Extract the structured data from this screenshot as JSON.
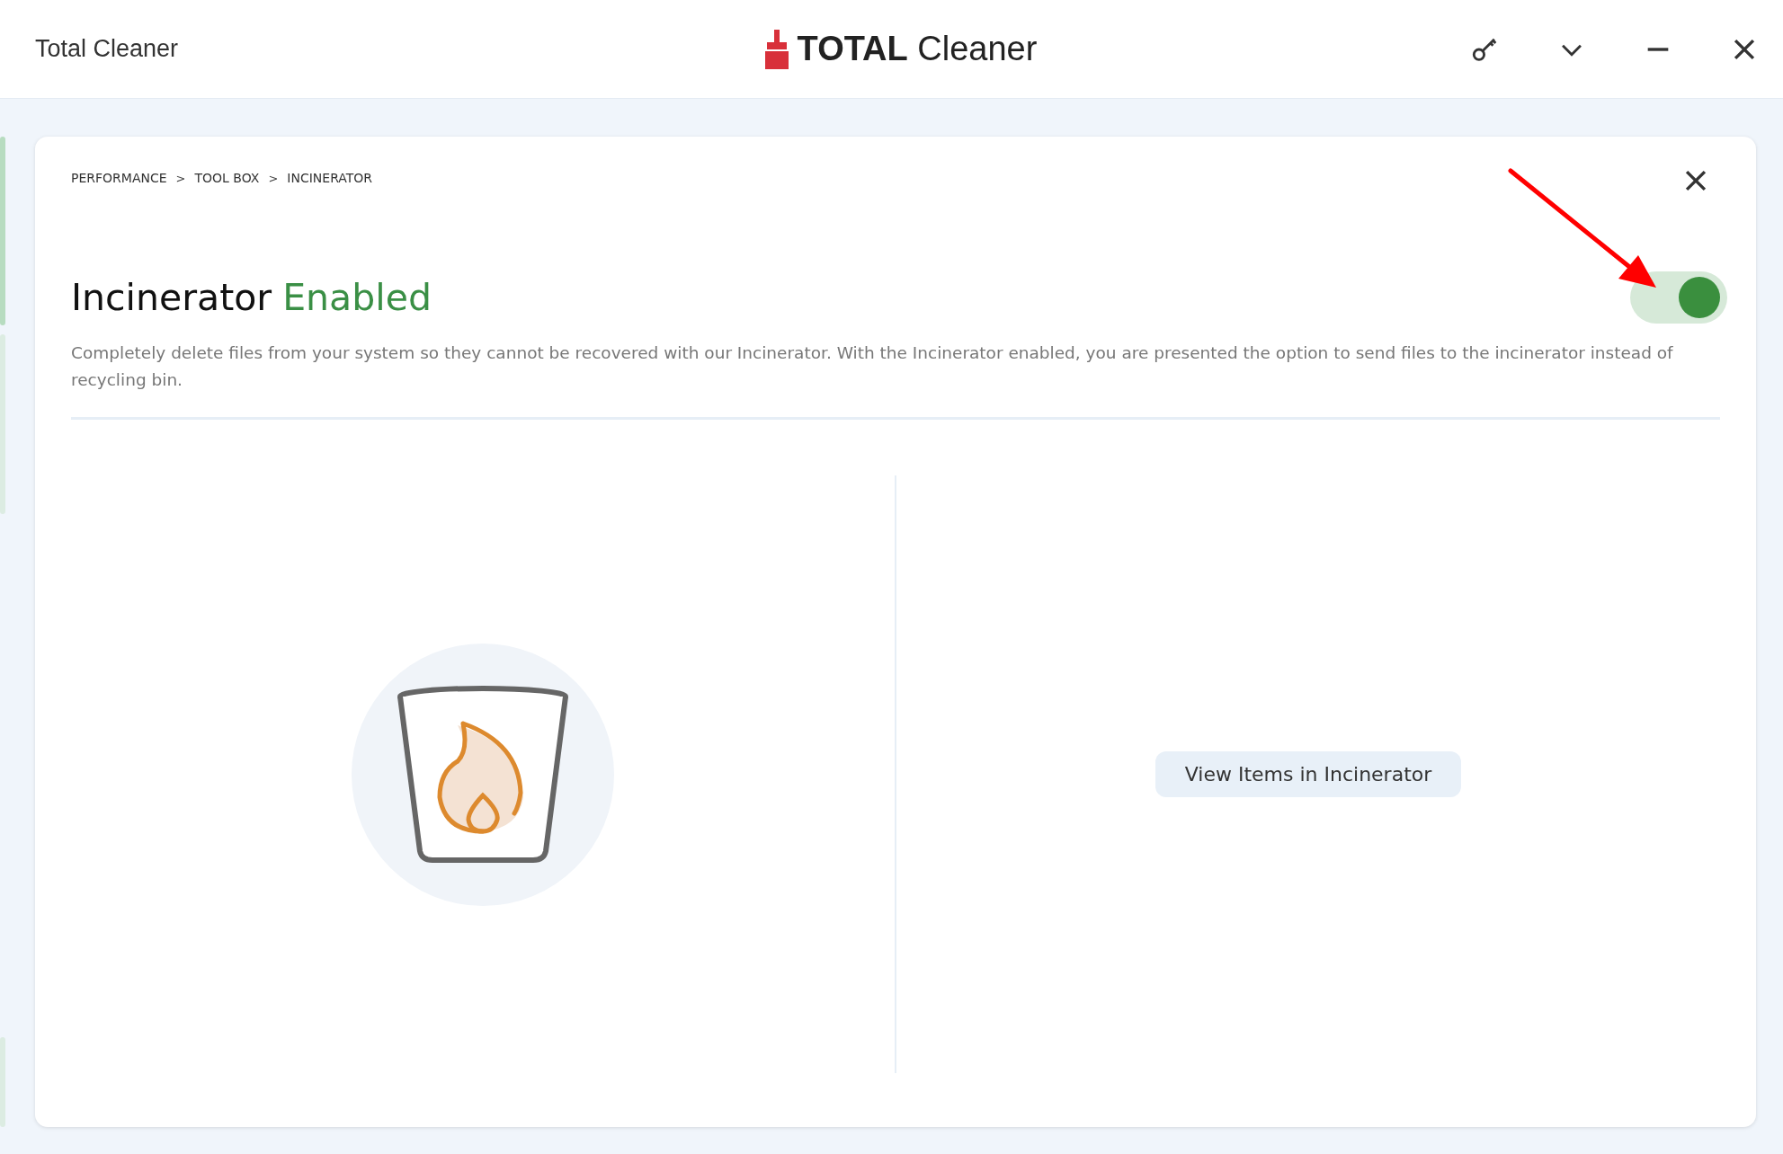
{
  "window": {
    "title": "Total Cleaner",
    "logo": {
      "bold": "TOTAL",
      "light": "Cleaner"
    }
  },
  "breadcrumb": {
    "separator": ">",
    "items": [
      "PERFORMANCE",
      "TOOL BOX",
      "INCINERATOR"
    ]
  },
  "heading": {
    "label": "Incinerator",
    "status": "Enabled"
  },
  "toggle": {
    "on": true
  },
  "description": "Completely delete files from your system so they cannot be recovered with our Incinerator. With the Incinerator enabled, you are presented the option to send files to the incinerator instead of recycling bin.",
  "action_button": "View Items in Incinerator"
}
